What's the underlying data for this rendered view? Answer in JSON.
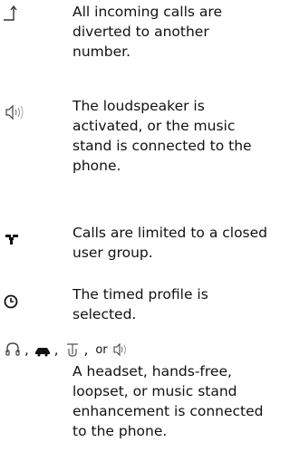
{
  "entries": [
    {
      "icon": "call-divert-icon",
      "text": "All incoming calls are diverted to another number."
    },
    {
      "icon": "loudspeaker-icon",
      "text": "The loudspeaker is activated, or the music stand is connected to the phone."
    },
    {
      "icon": "closed-user-group-icon",
      "text": "Calls are limited to a closed user group."
    },
    {
      "icon": "timed-profile-icon",
      "text": "The timed profile is selected."
    }
  ],
  "enhancements": {
    "icons": [
      "headset-icon",
      "hands-free-icon",
      "loopset-icon",
      "music-stand-icon"
    ],
    "comma": ",",
    "or": "or",
    "text": "A headset, hands-free, loopset, or music stand enhancement is connected to the phone."
  }
}
